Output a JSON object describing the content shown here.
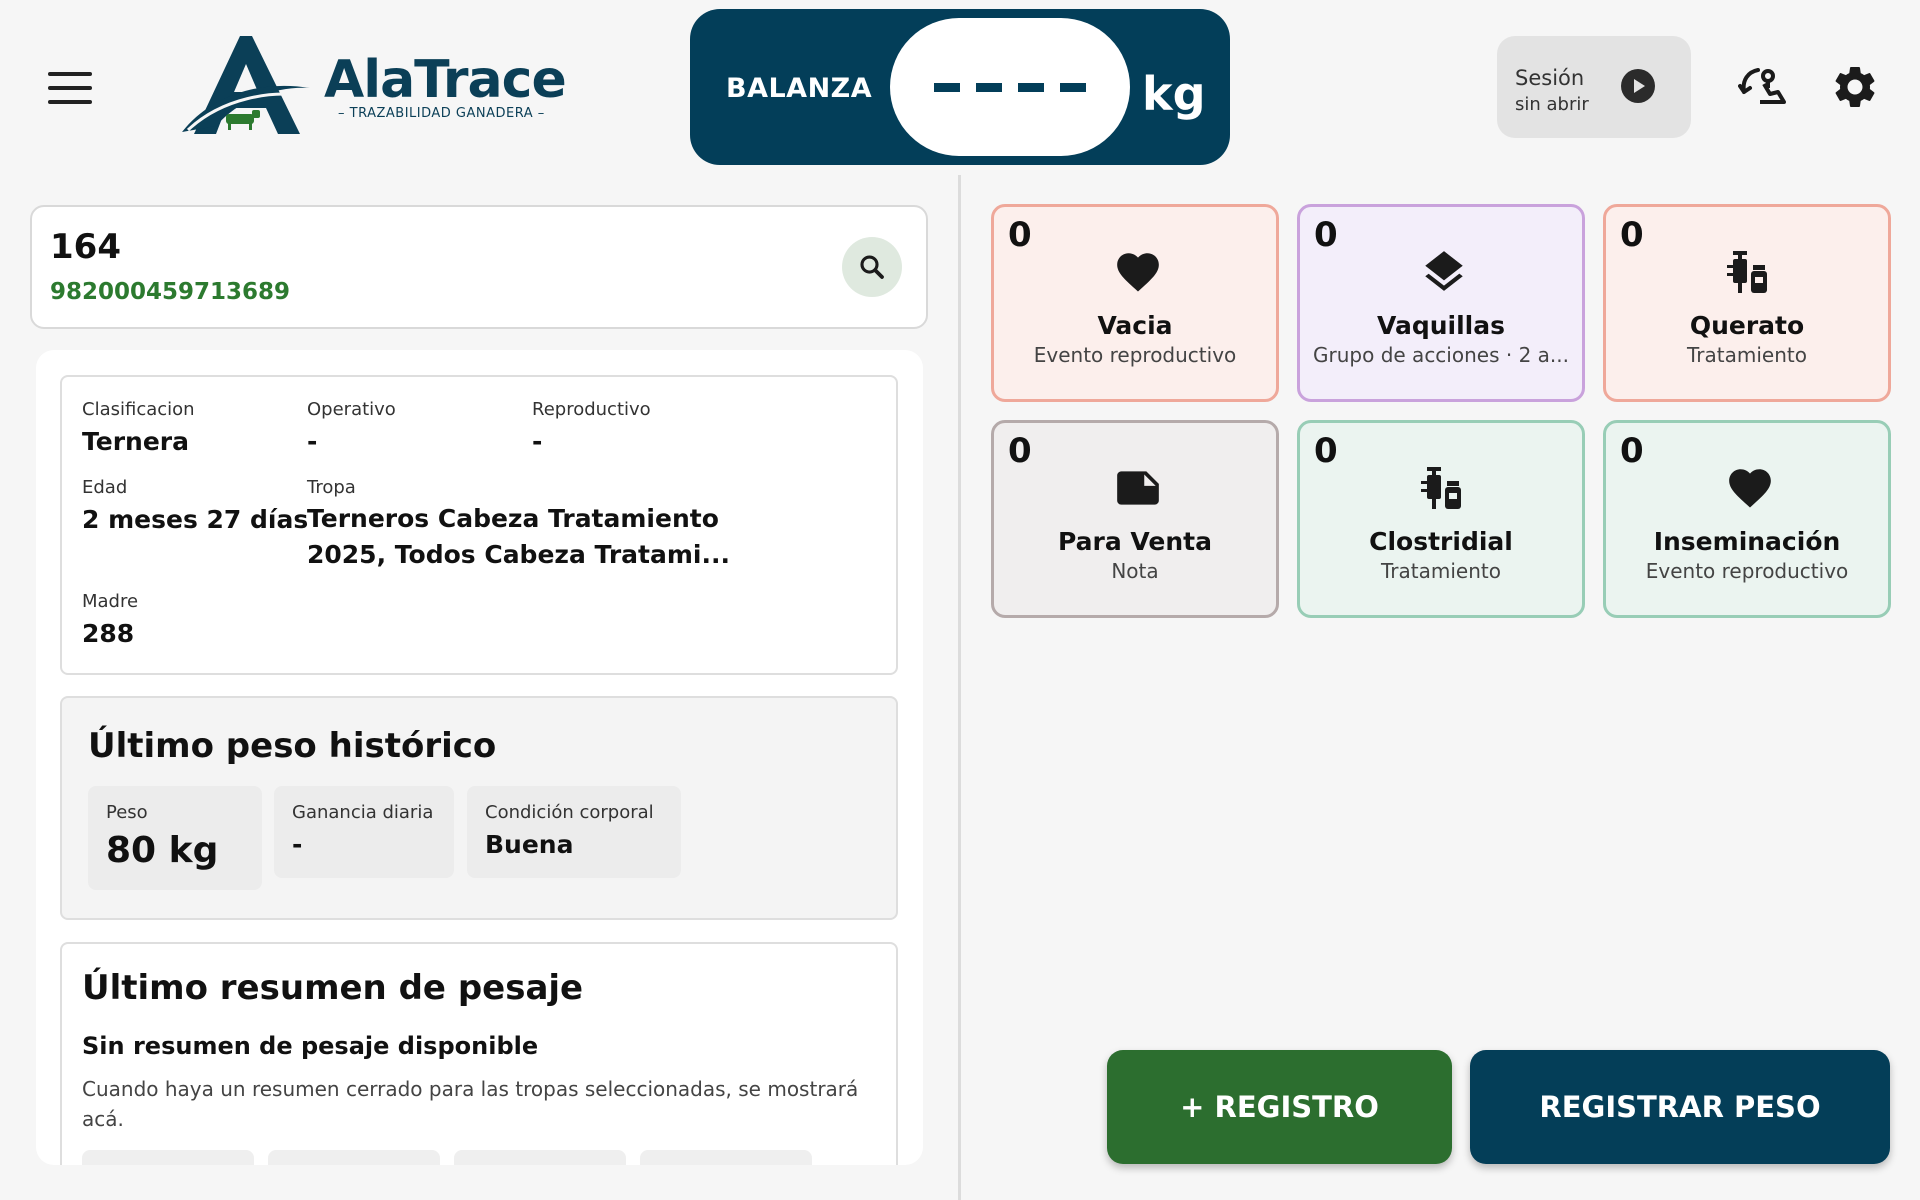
{
  "header": {
    "logo_name": "AlaTrace",
    "logo_tagline": "– TRAZABILIDAD GANADERA –",
    "balanza_label": "BALANZA",
    "balanza_value": "----",
    "balanza_unit": "kg",
    "sesion_title": "Sesión",
    "sesion_status": "sin abrir",
    "icons": [
      "menu-icon",
      "sync-icon",
      "gear-icon",
      "play-icon"
    ]
  },
  "search": {
    "animal_id": "164",
    "rfid": "982000459713689",
    "icon": "search-icon"
  },
  "info": {
    "clasificacion_label": "Clasificacion",
    "clasificacion_value": "Ternera",
    "operativo_label": "Operativo",
    "operativo_value": "-",
    "reproductivo_label": "Reproductivo",
    "reproductivo_value": "-",
    "edad_label": "Edad",
    "edad_value": "2 meses 27 días",
    "tropa_label": "Tropa",
    "tropa_line1": "Terneros Cabeza Tratamiento",
    "tropa_line2": "2025, Todos Cabeza Tratami...",
    "madre_label": "Madre",
    "madre_value": "288"
  },
  "ultimo_peso": {
    "title": "Último peso histórico",
    "peso_label": "Peso",
    "peso_value": "80 kg",
    "ganancia_label": "Ganancia diaria",
    "ganancia_value": "-",
    "condicion_label": "Condición corporal",
    "condicion_value": "Buena"
  },
  "resumen": {
    "title": "Último resumen de pesaje",
    "subtitle": "Sin resumen de pesaje disponible",
    "text": "Cuando haya un resumen cerrado para las tropas seleccionadas, se mostrará acá."
  },
  "tiles": [
    {
      "count": "0",
      "title": "Vacia",
      "subtitle": "Evento reproductivo",
      "icon": "heart-icon",
      "color": "#efa89a"
    },
    {
      "count": "0",
      "title": "Vaquillas",
      "subtitle": "Grupo de acciones · 2 a...",
      "icon": "layers-icon",
      "color": "#c9a2dc"
    },
    {
      "count": "0",
      "title": "Querato",
      "subtitle": "Tratamiento",
      "icon": "syringe-vial-icon",
      "color": "#efa89a"
    },
    {
      "count": "0",
      "title": "Para Venta",
      "subtitle": "Nota",
      "icon": "note-icon",
      "color": "#b5aaaa"
    },
    {
      "count": "0",
      "title": "Clostridial",
      "subtitle": "Tratamiento",
      "icon": "syringe-vial-icon",
      "color": "#98cdb6"
    },
    {
      "count": "0",
      "title": "Inseminación",
      "subtitle": "Evento reproductivo",
      "icon": "heart-icon",
      "color": "#98cdb6"
    }
  ],
  "actions": {
    "registro_label": "+ REGISTRO",
    "registrar_peso_label": "REGISTRAR PESO"
  },
  "colors": {
    "primary": "#043e58",
    "accent_green": "#2c6e2f",
    "rfid_green": "#2c7a2f"
  }
}
